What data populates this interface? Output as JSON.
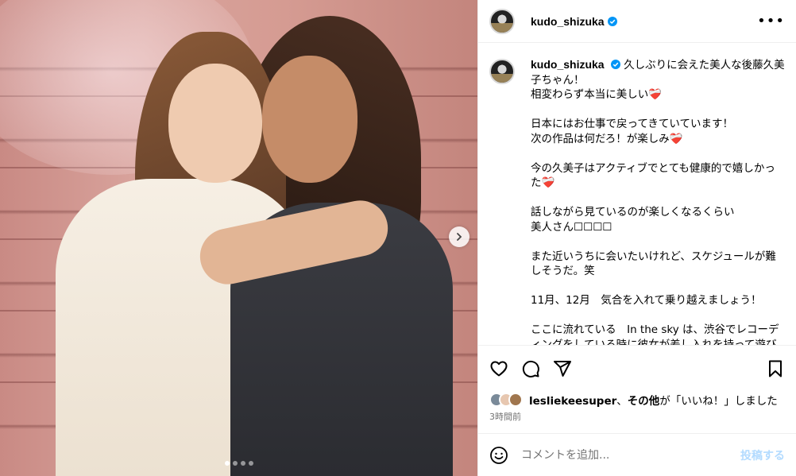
{
  "post": {
    "username": "kudo_shizuka",
    "caption": "久しぶりに会えた美人な後藤久美子ちゃん！\n相変わらず本当に美しい❤️‍🩹\n\n日本にはお仕事で戻ってきていています！\n次の作品は何だろ！が楽しみ❤️‍🩹\n\n今の久美子はアクティブでとても健康的で嬉しかった❤️‍🩹\n\n話しながら見ているのが楽しくなるくらい\n美人さん☐☐☐☐\n\nまた近いうちに会いたいけれど、スケジュールが難しそうだ。笑\n\n11月、12月　気合を入れて乗り越えましょう！\n\nここに流れている　In the sky は、渋谷でレコーディングをしている時に彼女が差し入れを持って遊びに来てくれたのを覚えています",
    "likes": {
      "user": "lesliekeesuper",
      "separator": "、",
      "others": "その他",
      "suffix": "が「いいね！」しました"
    },
    "time": "3時間前"
  },
  "comment": {
    "placeholder": "コメントを追加...",
    "post_label": "投稿する"
  },
  "carousel": {
    "slides": 4,
    "active": 1
  },
  "colors": {
    "verified": "#0095f6",
    "post_disabled": "#b3dbff",
    "heart": "#d11f3e"
  }
}
